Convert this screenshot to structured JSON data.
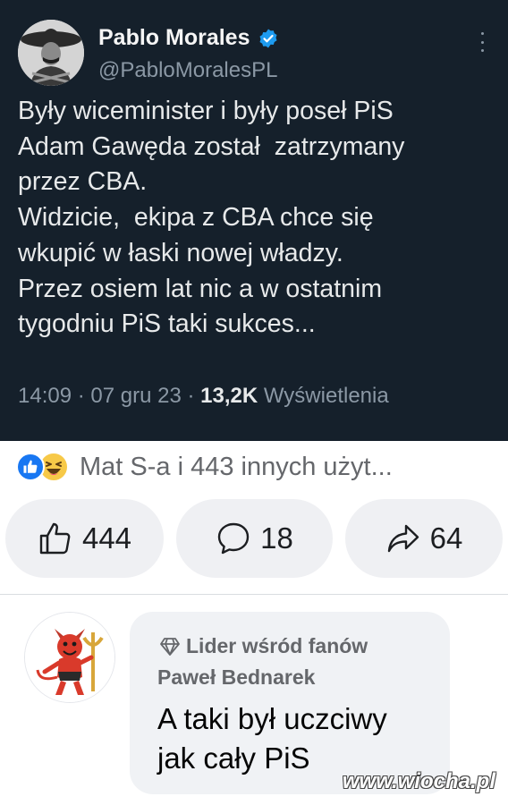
{
  "tweet": {
    "author_name": "Pablo Morales",
    "handle": "@PabloMoralesPL",
    "text_lines": [
      "Były wiceminister i były poseł PiS",
      "Adam Gawęda został  zatrzymany",
      "przez CBA.",
      "Widzicie,  ekipa z CBA chce się",
      "wkupić w łaski nowej władzy.",
      "Przez osiem lat nic a w ostatnim",
      "tygodniu PiS taki sukces..."
    ],
    "time": "14:09",
    "date": "07 gru 23",
    "views_count": "13,2K",
    "views_label": "Wyświetlenia",
    "separator": " · ",
    "icons": {
      "verified": "verified-badge-icon",
      "more": "more-vertical-icon"
    }
  },
  "reactions": {
    "summary": "Mat S-a i 443 innych użyt...",
    "icons": [
      "like-reaction-icon",
      "haha-reaction-icon"
    ]
  },
  "actions": {
    "like_count": "444",
    "comment_count": "18",
    "share_count": "64"
  },
  "comment": {
    "badge": "Lider wśród fanów",
    "author": "Paweł Bednarek",
    "text_lines": [
      "A taki był uczciwy",
      "jak cały PiS"
    ]
  },
  "watermark": "www.wiocha.pl",
  "colors": {
    "tweet_bg": "#15202b",
    "tweet_text": "#e7e9ea",
    "tweet_muted": "#8b98a5",
    "verified_blue": "#1d9bf0",
    "fb_blue": "#1877f2",
    "pill_bg": "#eff0f3",
    "bubble_bg": "#f0f2f5"
  }
}
